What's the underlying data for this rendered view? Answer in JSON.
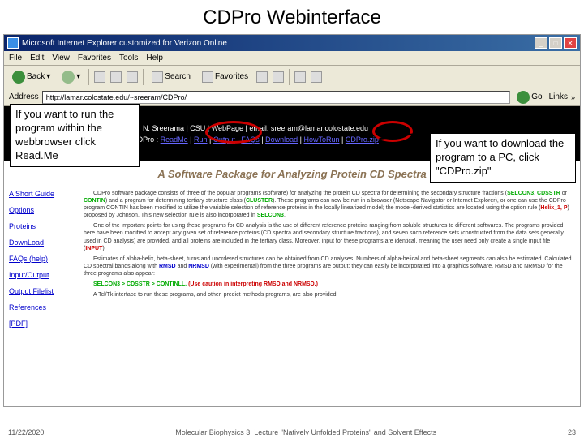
{
  "slide": {
    "title": "CDPro Webinterface"
  },
  "window": {
    "title": "Microsoft Internet Explorer customized for Verizon Online"
  },
  "menu": {
    "file": "File",
    "edit": "Edit",
    "view": "View",
    "favorites": "Favorites",
    "tools": "Tools",
    "help": "Help"
  },
  "toolbar": {
    "back": "Back",
    "search": "Search",
    "favorites": "Favorites"
  },
  "address": {
    "label": "Address",
    "url": "http://lamar.colostate.edu/~sreeram/CDPro/",
    "go": "Go",
    "links": "Links"
  },
  "header": {
    "line1": "N. Sreerama | CSU | WebPage | email: sreeram@lamar.colostate.edu",
    "line2_prefix": "CDPro : ",
    "readme": "ReadMe",
    "run": "Run",
    "output": "Output",
    "faqs": "FAQs",
    "download": "Download",
    "howto": "HowToRun",
    "zip": "CDPro.zip"
  },
  "package_title": "A Software Package for Analyzing Protein CD Spectra",
  "sidebar": {
    "items": [
      "A Short Guide",
      "Options",
      "Proteins",
      "DownLoad",
      "FAQs (help)",
      "Input/Output",
      "Output Filelist",
      "References",
      "[PDF]"
    ]
  },
  "body": {
    "p1_a": "CDPro software package consists of three of the popular programs (software) for analyzing the protein CD spectra for determining the secondary structure fractions (",
    "selcon": "SELCON3",
    "cdsstr": "CDSSTR",
    "contin": "CONTIN",
    "p1_b": ") and a program for determining tertiary structure class (",
    "cluster": "CLUSTER",
    "p1_c": "). These programs can now be run in a browser (Netscape Navigator or Internet Explorer), or one can use the CDPro program CONTIN has been modified to utilize the variable selection of reference proteins in the locally linearized model; the model-derived statistics are located using the option rule (",
    "helix": "Helix_1, P",
    "p1_d": ") proposed by Johnson. This new selection rule is also incorporated in ",
    "p2_a": "One of the important points for using these programs for CD analysis is the use of different reference proteins ranging from soluble structures to different softwares. The programs provided here have been modified to accept any given set of reference proteins (CD spectra and secondary structure fractions), and seven such reference sets (constructed from the data sets generally used in CD analysis) are provided, and all proteins are included in the tertiary class. Moreover, input for these programs are identical, meaning the user need only create a single input file (",
    "input": "INPUT",
    "p2_b": ").",
    "p3_a": "Estimates of alpha-helix, beta-sheet, turns and unordered structures can be obtained from CD analyses. Numbers of alpha-helical and beta-sheet segments can also be estimated. Calculated CD spectral bands along with ",
    "rmsd": "RMSD",
    "nrmsd": "NRMSD",
    "p3_b": " (with experimental) from the three programs are output; they can easily be incorporated into a graphics software. RMSD and NRMSD for the three programs also appear:",
    "p4_a": "SELCON3 > CDSSTR > CONTINLL. ",
    "caution": "(Use caution in interpreting RMSD and NRMSD.)",
    "p5": "A Tcl/Tk interface to run these programs, and other, predict methods programs, are also provided."
  },
  "callouts": {
    "c1": "If you want to run the program within the webbrowser click Read.Me",
    "c2": "If you want to download the program to a PC, click \"CDPro.zip\""
  },
  "footer": {
    "date": "11/22/2020",
    "lecture": "Molecular Biophysics 3: Lecture \"Natively Unfolded Proteins\" and Solvent Effects",
    "page": "23"
  }
}
